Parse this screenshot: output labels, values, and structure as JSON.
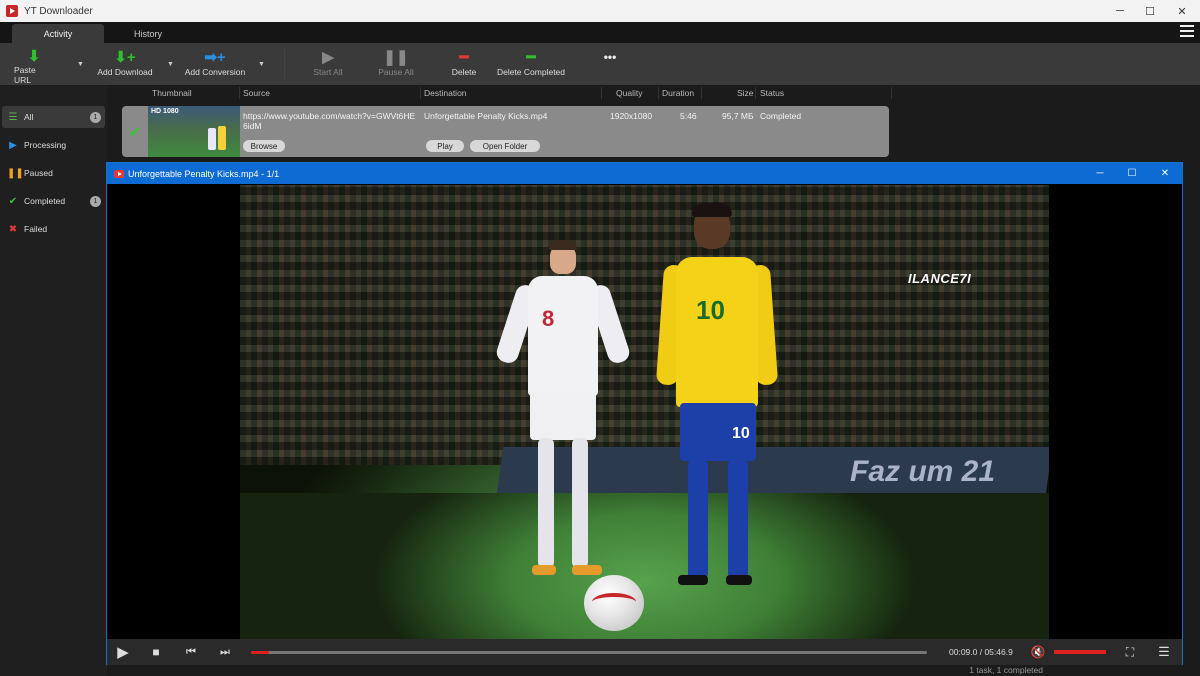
{
  "window": {
    "title": "YT Downloader"
  },
  "tabs": [
    {
      "label": "Activity"
    },
    {
      "label": "History"
    }
  ],
  "toolbar": {
    "paste_url": "Paste URL",
    "add_download": "Add Download",
    "add_conversion": "Add Conversion",
    "start_all": "Start All",
    "pause_all": "Pause All",
    "delete": "Delete",
    "delete_completed": "Delete Completed",
    "more": "•••"
  },
  "sidebar": {
    "items": [
      {
        "label": "All",
        "badge": "1",
        "icon": "list-icon"
      },
      {
        "label": "Processing",
        "icon": "play-icon"
      },
      {
        "label": "Paused",
        "icon": "pause-icon"
      },
      {
        "label": "Completed",
        "badge": "1",
        "icon": "check-icon"
      },
      {
        "label": "Failed",
        "icon": "cross-icon"
      }
    ]
  },
  "table": {
    "columns": [
      "Thumbnail",
      "Source",
      "Destination",
      "Quality",
      "Duration",
      "Size",
      "Status"
    ],
    "rows": [
      {
        "thumb_badge": "HD 1080",
        "source": "https://www.youtube.com/watch?v=GWVt6HE6idM",
        "destination": "Unforgettable Penalty Kicks.mp4",
        "quality": "1920x1080",
        "duration": "5:46",
        "size": "95,7 МБ",
        "status": "Completed",
        "browse": "Browse",
        "play": "Play",
        "open_folder": "Open Folder"
      }
    ]
  },
  "player": {
    "title": "Unforgettable Penalty Kicks.mp4 - 1/1",
    "watermark": "ILANCE7I",
    "ad_text": "Faz um 21",
    "shirt_number_left": "8",
    "shirt_number_right": "10",
    "time": "00:09.0 / 05:46.9",
    "progress_fraction": 0.026,
    "volume_fraction": 1.0
  },
  "status": {
    "text": "1 task, 1 completed"
  },
  "colors": {
    "accent": "#0d6bd3",
    "seek": "#e02020",
    "ok": "#3fbf3f"
  }
}
